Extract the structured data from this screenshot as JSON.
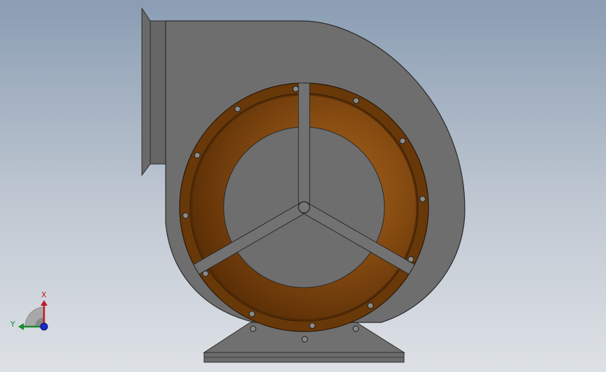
{
  "viewport": {
    "background_top": "#8a9db3",
    "background_bottom": "#dde1e6"
  },
  "model": {
    "housing_color": "#6e6e6e",
    "housing_stroke": "#2a2a2a",
    "flange_color": "#6a3a0c",
    "inlet_cone_color": "#8a4e10",
    "strut_color": "#727272",
    "bolt_count_flange": 12,
    "strut_count": 3
  },
  "triad": {
    "x_label": "X",
    "y_label": "Y",
    "x_color": "#c0182a",
    "y_color": "#1a8a2a",
    "z_color": "#1a2ad0"
  }
}
